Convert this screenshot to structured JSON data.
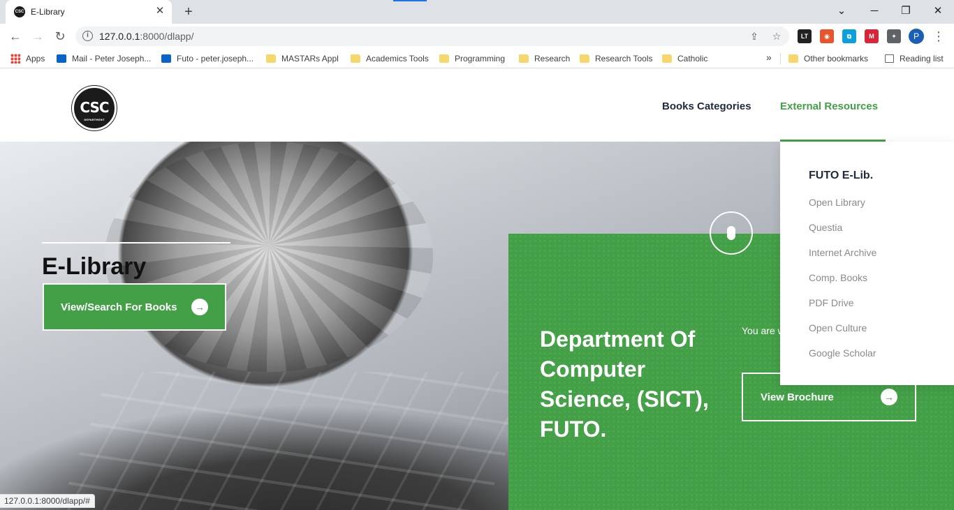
{
  "browser": {
    "tab_title": "E-Library",
    "tab_close": "✕",
    "new_tab": "+",
    "url_host": "127.0.0.1",
    "url_rest": ":8000/dlapp/",
    "window": {
      "minimize": "⌄",
      "restore": "─",
      "maximize": "❐",
      "close": "✕"
    },
    "nav": {
      "back": "←",
      "forward": "→",
      "reload": "↻"
    },
    "profile_initial": "P",
    "extensions": [
      {
        "label": "LT",
        "color": "#222222",
        "icon": "languagetool-icon"
      },
      {
        "label": "◉",
        "color": "#e4572e",
        "icon": "color-wheel-icon"
      },
      {
        "label": "⧉",
        "color": "#0aa0d8",
        "icon": "screenshot-icon"
      },
      {
        "label": "M",
        "color": "#d6263c",
        "icon": "mendeley-icon"
      },
      {
        "label": "✦",
        "color": "#5f6368",
        "icon": "puzzle-icon"
      }
    ],
    "accent_color": "#1a73e8"
  },
  "bookmarks": {
    "items": [
      {
        "label": "Apps",
        "type": "apps"
      },
      {
        "label": "Mail - Peter Joseph...",
        "type": "outlook"
      },
      {
        "label": "Futo - peter.joseph...",
        "type": "outlook"
      },
      {
        "label": "MASTARs Appl",
        "type": "folder"
      },
      {
        "label": "Academics Tools",
        "type": "folder"
      },
      {
        "label": "Programming",
        "type": "folder"
      },
      {
        "label": "Research",
        "type": "folder"
      },
      {
        "label": "Research Tools",
        "type": "folder"
      },
      {
        "label": "Catholic",
        "type": "folder"
      }
    ],
    "overflow": "»",
    "other": "Other bookmarks",
    "reading_list": "Reading list"
  },
  "site": {
    "logo_text": "CSC",
    "logo_sub": "DEPARTMENT",
    "nav": {
      "categories": "Books Categories",
      "external": "External Resources"
    },
    "hero_title": "E-Library",
    "search_button": "View/Search For Books",
    "dept_title": "Department Of Computer Science, (SICT), FUTO.",
    "intro_text": "You are w resource",
    "brochure_button": "View Brochure",
    "arrow": "→",
    "dropdown": [
      "FUTO E-Lib.",
      "Open Library",
      "Questia",
      "Internet Archive",
      "Comp. Books",
      "PDF Drive",
      "Open Culture",
      "Google Scholar"
    ],
    "brand_green": "#43a047",
    "nav_dark": "#1f2a3c"
  },
  "status_url": "127.0.0.1:8000/dlapp/#"
}
